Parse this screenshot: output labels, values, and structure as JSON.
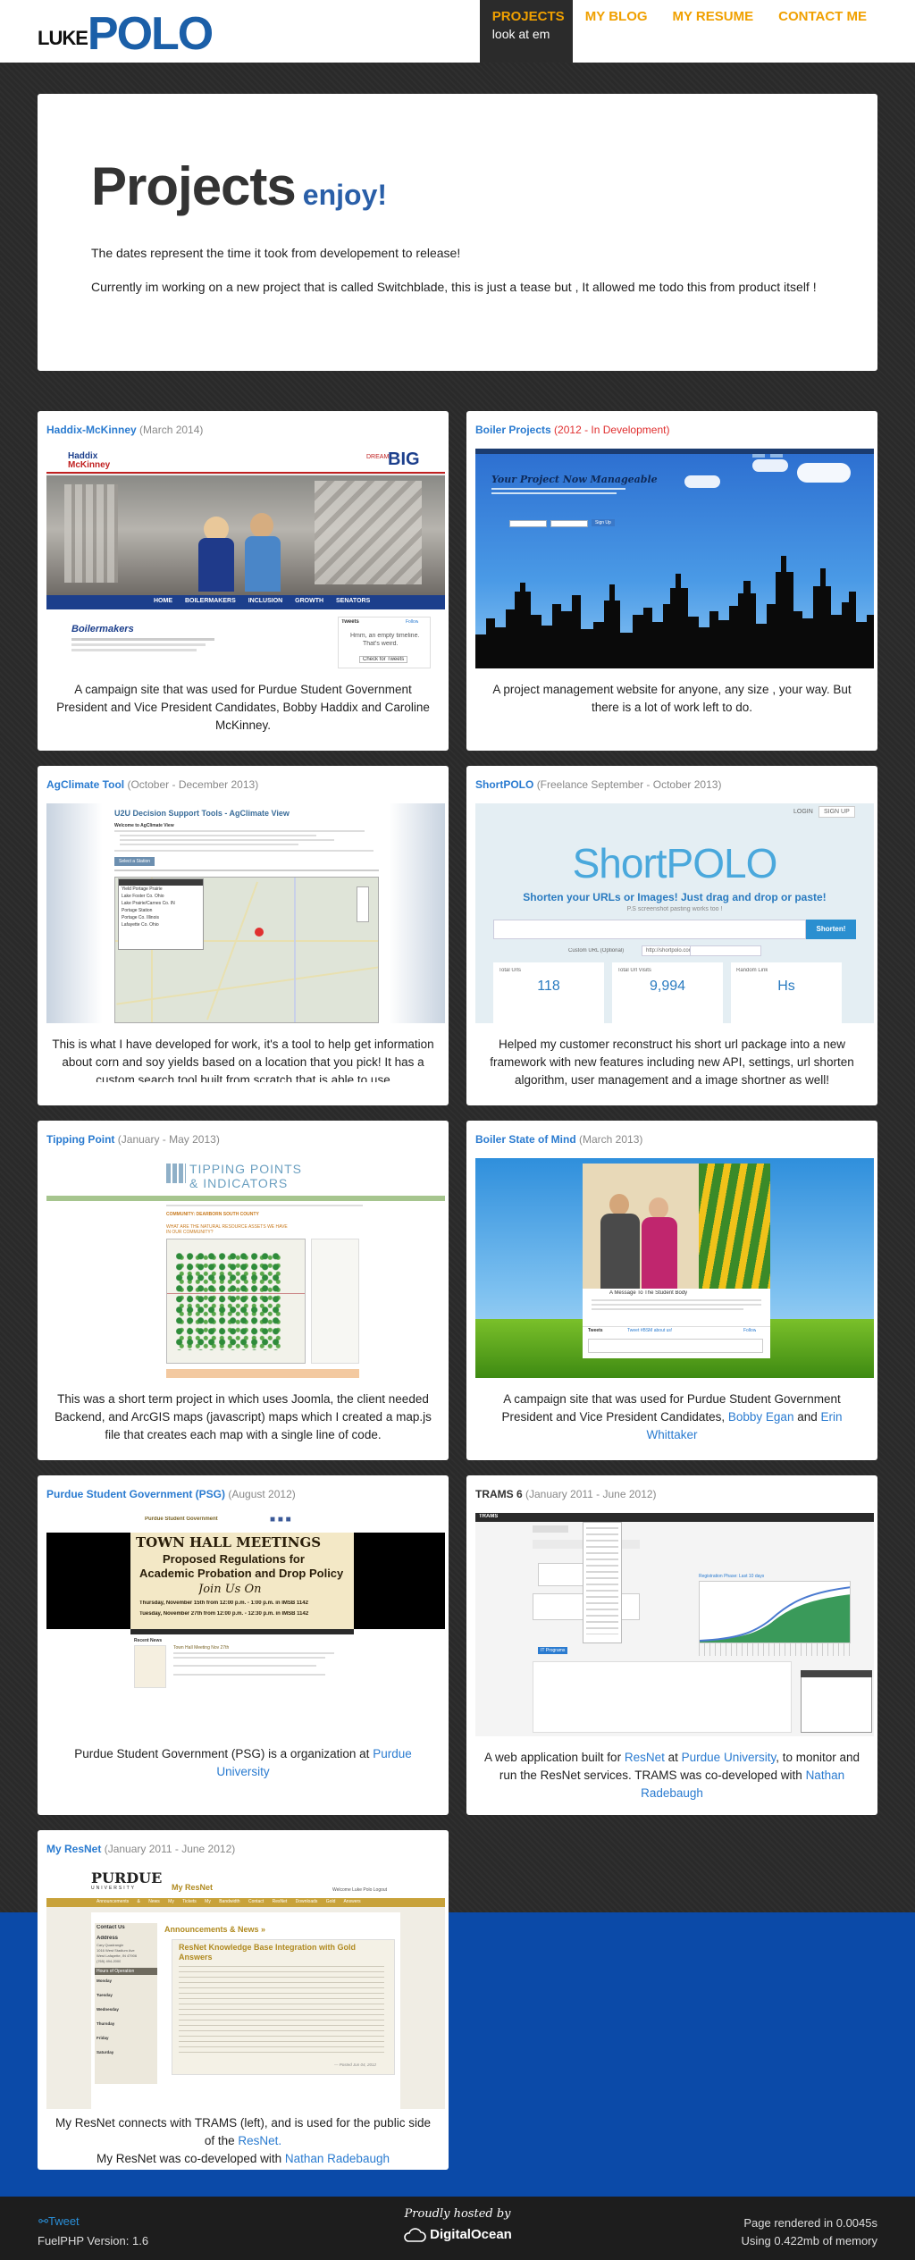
{
  "site": {
    "logo_luke": "LUKE",
    "logo_polo": "POLO"
  },
  "nav": {
    "projects": "PROJECTS",
    "projects_sub": "look at em",
    "blog": "MY BLOG",
    "resume": "MY RESUME",
    "contact": "CONTACT ME"
  },
  "hero": {
    "title": "Projects",
    "title_small": "enjoy!",
    "line1": "The dates represent the time it took from developement to release!",
    "line2": "Currently im working on a new project that is called Switchblade, this is just a tease but , It allowed me todo this from product itself !"
  },
  "cards": [
    {
      "title": "Haddix-McKinney",
      "date": "(March 2014)",
      "desc": "A campaign site that was used for Purdue Student Government President and Vice President Candidates, Bobby Haddix and Caroline McKinney.",
      "shot": {
        "logo_line1": "Haddix",
        "logo_line2": "McKinney",
        "tag1": "DREAM",
        "tag2": "BIG",
        "menu": [
          "HOME",
          "BOILERMAKERS",
          "INCLUSION",
          "GROWTH",
          "SENATORS"
        ],
        "section": "Boilermakers",
        "tweets": "Tweets",
        "follow": "Follow",
        "empty1": "Hmm, an empty timeline.",
        "empty2": "That's weird.",
        "check": "Check for Tweets"
      }
    },
    {
      "title": "Boiler Projects",
      "date": "(2012 - In Development)",
      "desc": "A project management website for anyone, any size , your way. But there is a lot of work left to do.",
      "shot": {
        "headline": "Your Project Now Manageable",
        "button": "Sign Up"
      }
    },
    {
      "title": "AgClimate Tool",
      "date": "(October - December 2013)",
      "desc": "This is what I have developed for work, it's a tool to help get information about corn and soy yields based on a location that you pick! It has a custom search tool built from scratch that is able to use",
      "shot": {
        "header": "U2U Decision Support Tools - AgClimate View",
        "welcome": "Welcome to AgClimate View",
        "select": "Select a Station",
        "list": [
          "Yield Portage Prairie",
          "Lake Foster Co. Ohio",
          "Lake Prairie/Carnes Co. IN",
          "Portage Station",
          "Portage Co. Illinois",
          "Lafayette Co. Ohio"
        ]
      }
    },
    {
      "title": "ShortPOLO",
      "date": "(Freelance September - October 2013)",
      "desc": "Helped my customer reconstruct his short url package into a new framework with new features including new API, settings, url shorten algorithm, user management and a image shortner as well!",
      "shot": {
        "login": "LOGIN",
        "signup": "SIGN UP",
        "brand": "ShortPOLO",
        "tagline": "Shorten your URLs or Images! Just drag and drop or paste!",
        "sub": "P.S screenshot pasting works too !",
        "button": "Shorten!",
        "custom": "Custom URL (Optional)",
        "prefix": "http://shortpolo.com",
        "stats": [
          {
            "label": "Total Urls",
            "value": "118"
          },
          {
            "label": "Total Url Visits",
            "value": "9,994"
          },
          {
            "label": "Random Link",
            "value": "Hs"
          }
        ]
      }
    },
    {
      "title": "Tipping Point",
      "date": "(January - May 2013)",
      "desc": "This was a short term project in which uses Joomla, the client needed Backend, and ArcGIS maps (javascript) maps which I created a map.js file that creates each map with a single line of code.",
      "shot": {
        "brand1": "TIPPING POINTS",
        "brand2": "& INDICATORS",
        "county": "COMMUNITY: DEARBORN SOUTH COUNTY",
        "question": "WHAT ARE THE NATURAL RESOURCE ASSETS WE HAVE IN OUR COMMUNITY?"
      }
    },
    {
      "title": "Boiler State of Mind",
      "date": "(March 2013)",
      "desc_pre": "A campaign site that was used for Purdue Student Government President and Vice President Candidates,",
      "link1": "Bobby Egan",
      "desc_mid": "and",
      "link2": "Erin Whittaker",
      "shot": {
        "caption": "A Message To The Student Body",
        "tweets": "Tweets",
        "tweet_label": "Tweet #BSM about us!",
        "follow": "Follow"
      }
    },
    {
      "title": "Purdue Student Government (PSG)",
      "date": "(August 2012)",
      "desc_pre": "Purdue Student Government (PSG) is a organization at",
      "link1": "Purdue University",
      "shot": {
        "hdr": "Purdue Student Government",
        "banner1": "TOWN HALL MEETINGS",
        "banner2": "Proposed Regulations for",
        "banner3": "Academic Probation and Drop Policy",
        "banner4": "Join Us On",
        "banner5": "Thursday, November 15th from 12:00 p.m. - 1:00 p.m. in IMSB 1142",
        "banner6": "Tuesday, November 27th from 12:00 p.m. - 12:30 p.m. in IMSB 1142",
        "recent": "Recent News",
        "post": "Town Hall Meeting Nov 27th"
      }
    },
    {
      "title": "TRAMS 6",
      "date": "(January 2011 - June 2012)",
      "desc_pre": "A web application built for",
      "link1": "ResNet",
      "desc_mid": "at",
      "link2": "Purdue University",
      "desc_mid2": ", to monitor and run the ResNet services. TRAMS was co-developed with",
      "link3": "Nathan Radebaugh",
      "shot": {
        "bar": "TRAMS",
        "title": "Registration Phase: Last 10 days",
        "stat": "IT Programs"
      }
    },
    {
      "title": "My ResNet",
      "date": "(January 2011 - June 2012)",
      "desc_line1": "My ResNet connects with TRAMS (left), and is used for the public side of the",
      "link1": "ResNet.",
      "desc_line2": "My ResNet was co-developed with",
      "link2": "Nathan Radebaugh",
      "shot": {
        "purdue": "PURDUE",
        "university": "UNIVERSITY",
        "myresnet": "My ResNet",
        "welcome": "Welcome Luke Polo   Logout",
        "menu": [
          "Announcements & News",
          "My Tickets",
          "My Bandwidth",
          "Contact ResNet",
          "Downloads",
          "Gold Answers"
        ],
        "contact": "Contact Us",
        "address": "Address",
        "address_lines": [
          "Cary Quadrangle",
          "1016 West Stadium Ave",
          "West Lafayette, IN 47906",
          "(765) 494-2000"
        ],
        "hours": "Hours of Operation",
        "days": [
          "Monday",
          "Tuesday",
          "Wednesday",
          "Thursday",
          "Friday",
          "Saturday"
        ],
        "announce": "Announcements & News »",
        "headline": "ResNet Knowledge Base Integration with Gold Answers",
        "posted": "— Posted Jun 04, 2012"
      }
    }
  ],
  "footer": {
    "tweet": "Tweet",
    "fuel": "FuelPHP Version: 1.6",
    "hosted": "Proudly hosted by",
    "do": "DigitalOcean",
    "rendered": "Page rendered in 0.0045s",
    "memory": "Using 0.422mb of memory"
  },
  "colors": {
    "accent": "#f0a000",
    "link": "#2a7bd0",
    "brand": "#1b5fa8"
  }
}
